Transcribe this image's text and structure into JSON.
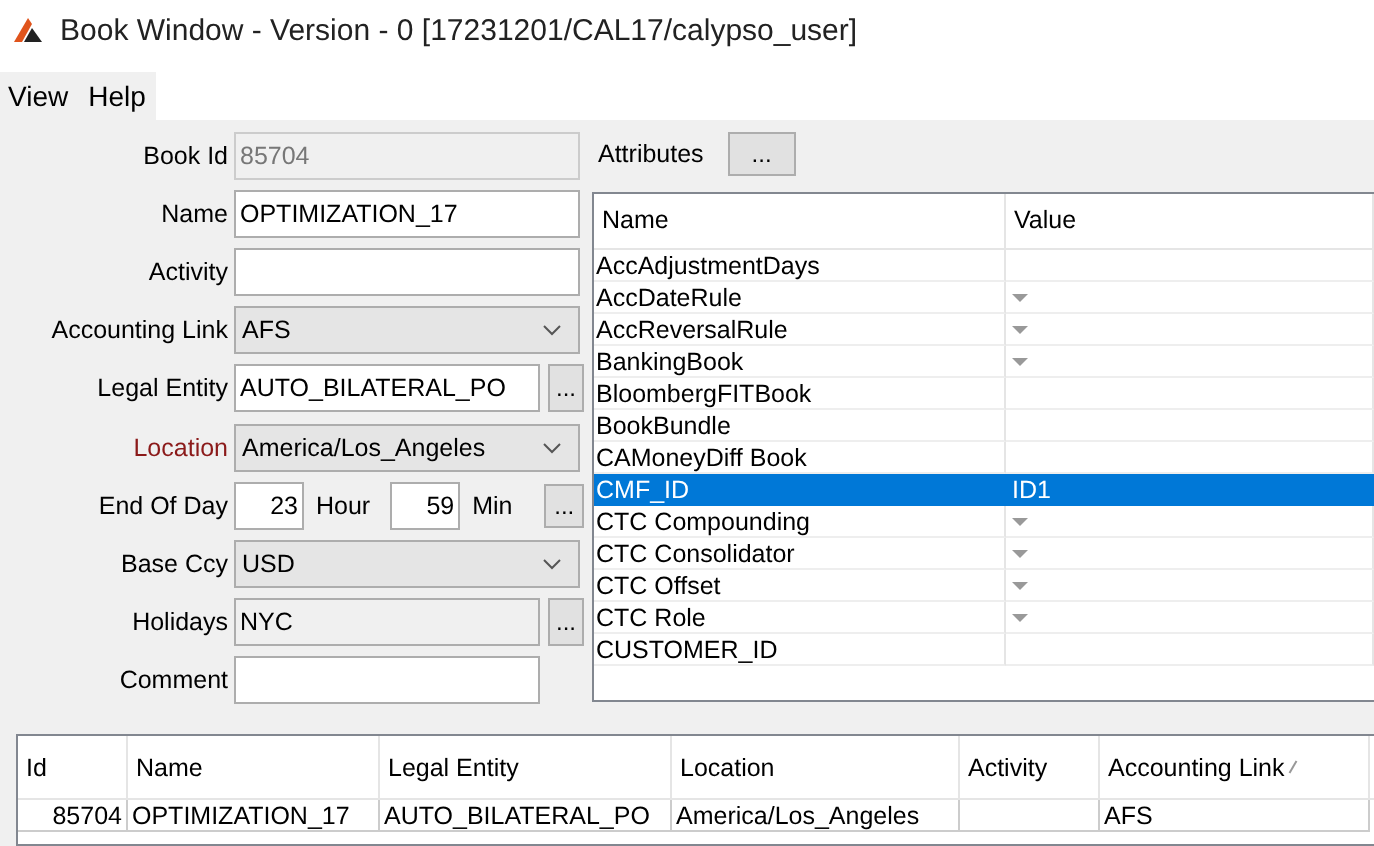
{
  "window": {
    "title": "Book Window - Version - 0 [17231201/CAL17/calypso_user]"
  },
  "menu": [
    {
      "label": "View"
    },
    {
      "label": "Help"
    }
  ],
  "form": {
    "fields": [
      {
        "label": "Book Id",
        "kind": "text",
        "value": "85704",
        "disabled": true,
        "readonly": false,
        "required": false
      },
      {
        "label": "Name",
        "kind": "text",
        "value": "OPTIMIZATION_17",
        "disabled": false,
        "readonly": false,
        "required": false
      },
      {
        "label": "Activity",
        "kind": "text",
        "disabled": false,
        "readonly": false,
        "required": false
      },
      {
        "label": "Accounting Link",
        "kind": "combo",
        "value": "AFS",
        "disabled": false,
        "required": false
      },
      {
        "label": "Legal Entity",
        "kind": "lookup",
        "value": "AUTO_BILATERAL_PO",
        "button": "...",
        "disabled": false,
        "readonly": false,
        "required": false
      },
      {
        "label": "Location",
        "kind": "combo",
        "value": "America/Los_Angeles",
        "disabled": false,
        "required": true
      },
      {
        "label": "End Of Day",
        "kind": "time",
        "hour": "23",
        "hour_unit": "Hour",
        "minute": "59",
        "minute_unit": "Min",
        "button": "...",
        "disabled": false,
        "readonly": false,
        "required": false
      },
      {
        "label": "Base Ccy",
        "kind": "combo",
        "value": "USD",
        "disabled": false,
        "required": false
      },
      {
        "label": "Holidays",
        "kind": "lookup",
        "value": "NYC",
        "button": "...",
        "disabled": false,
        "readonly": true,
        "required": false
      },
      {
        "label": "Comment",
        "kind": "short",
        "disabled": false,
        "readonly": false,
        "required": false
      }
    ]
  },
  "attributes": {
    "label": "Attributes",
    "button": "...",
    "columns": [
      "Name",
      "Value"
    ],
    "rows": [
      {
        "name": "AccAdjustmentDays",
        "dropdown": false,
        "selected": false
      },
      {
        "name": "AccDateRule",
        "dropdown": true,
        "selected": false
      },
      {
        "name": "AccReversalRule",
        "dropdown": true,
        "selected": false
      },
      {
        "name": "BankingBook",
        "dropdown": true,
        "selected": false
      },
      {
        "name": "BloombergFITBook",
        "dropdown": false,
        "selected": false
      },
      {
        "name": "BookBundle",
        "dropdown": false,
        "selected": false
      },
      {
        "name": "CAMoneyDiff Book",
        "dropdown": false,
        "selected": false
      },
      {
        "name": "CMF_ID",
        "value": "ID1",
        "dropdown": false,
        "selected": true
      },
      {
        "name": "CTC Compounding",
        "dropdown": true,
        "selected": false
      },
      {
        "name": "CTC Consolidator",
        "dropdown": true,
        "selected": false
      },
      {
        "name": "CTC Offset",
        "dropdown": true,
        "selected": false
      },
      {
        "name": "CTC Role",
        "dropdown": true,
        "selected": false
      },
      {
        "name": "CUSTOMER_ID",
        "dropdown": false,
        "selected": false
      }
    ]
  },
  "books_table": {
    "columns": [
      {
        "label": "Id",
        "sorted": false
      },
      {
        "label": "Name",
        "sorted": false
      },
      {
        "label": "Legal Entity",
        "sorted": false
      },
      {
        "label": "Location",
        "sorted": false
      },
      {
        "label": "Activity",
        "sorted": false
      },
      {
        "label": "Accounting Link",
        "sorted": true
      }
    ],
    "rows": [
      {
        "cells": [
          "85704",
          "OPTIMIZATION_17",
          "AUTO_BILATERAL_PO",
          "America/Los_Angeles",
          null,
          "AFS"
        ]
      }
    ]
  }
}
